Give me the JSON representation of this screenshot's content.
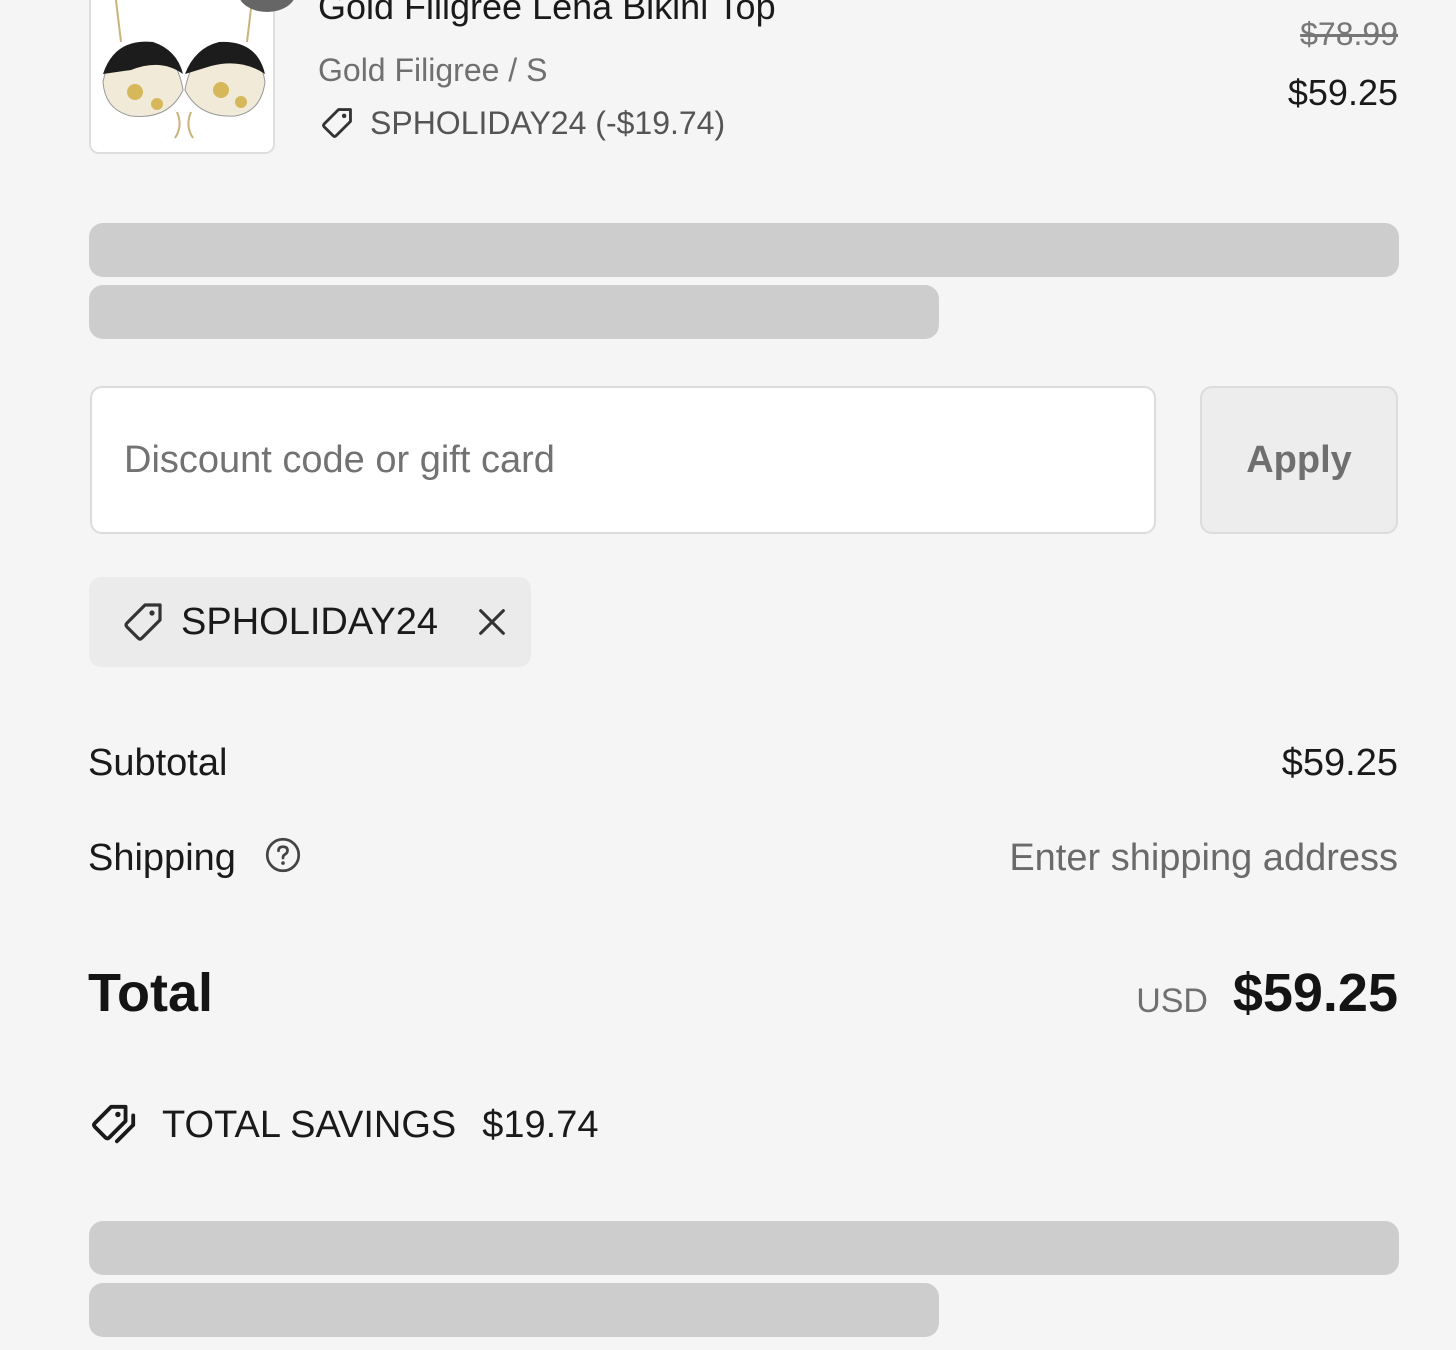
{
  "line_item": {
    "title": "Gold Filigree Lena Bikini Top",
    "variant": "Gold Filigree / S",
    "discount_label": "SPHOLIDAY24 (-$19.74)",
    "price_original": "$78.99",
    "price_current": "$59.25",
    "image_alt": "bikini-top-thumbnail"
  },
  "discount": {
    "placeholder": "Discount code or gift card",
    "value": "",
    "apply_label": "Apply"
  },
  "applied_code": {
    "label": "SPHOLIDAY24"
  },
  "summary": {
    "subtotal_label": "Subtotal",
    "subtotal_value": "$59.25",
    "shipping_label": "Shipping",
    "shipping_value": "Enter shipping address",
    "total_label": "Total",
    "total_currency": "USD",
    "total_value": "$59.25"
  },
  "savings": {
    "label": "TOTAL SAVINGS",
    "amount": "$19.74"
  },
  "colors": {
    "background": "#f5f5f5",
    "skeleton": "#cdcdcd",
    "chip_bg": "#ebebeb",
    "text": "#141414"
  }
}
